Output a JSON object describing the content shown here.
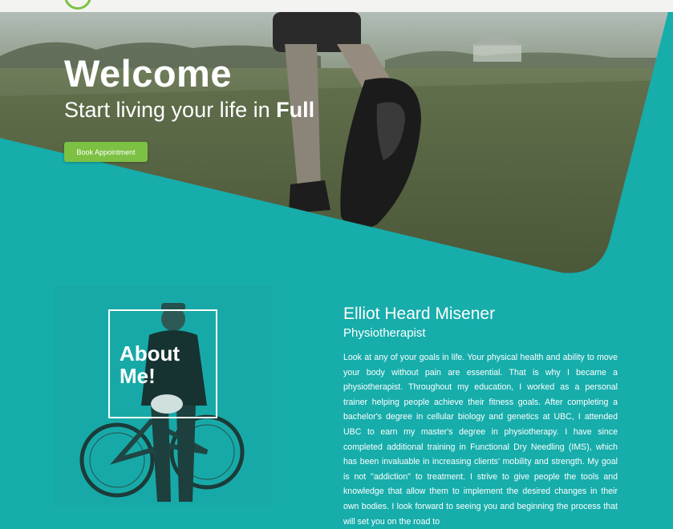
{
  "hero": {
    "title": "Welcome",
    "subtitle_prefix": "Start living your life in ",
    "subtitle_bold": "Full",
    "button_label": "Book Appointment"
  },
  "about": {
    "heading": "About Me!"
  },
  "profile": {
    "name": "Elliot Heard Misener",
    "role": "Physiotherapist",
    "bio": "Look at any of your goals in life. Your physical health and ability to move your body without pain are essential. That is why I became a physiotherapist. Throughout my education, I worked as a personal trainer helping people achieve their fitness goals. After completing a bachelor's degree in cellular biology and genetics at UBC, I attended UBC to earn my master's degree in physiotherapy. I have since completed additional training in Functional Dry Needling (IMS), which has been invaluable in increasing clients' mobility and strength. My goal is not \"addiction\" to treatment. I strive to give people the tools and knowledge that allow them to implement the desired changes in their own bodies. I look forward to seeing you and beginning the process that will set you on the road to"
  },
  "colors": {
    "teal": "#16adab",
    "accent_green": "#7cc144",
    "topbar": "#f3f4f2"
  },
  "icons": {
    "logo": "circle-logo-icon"
  }
}
